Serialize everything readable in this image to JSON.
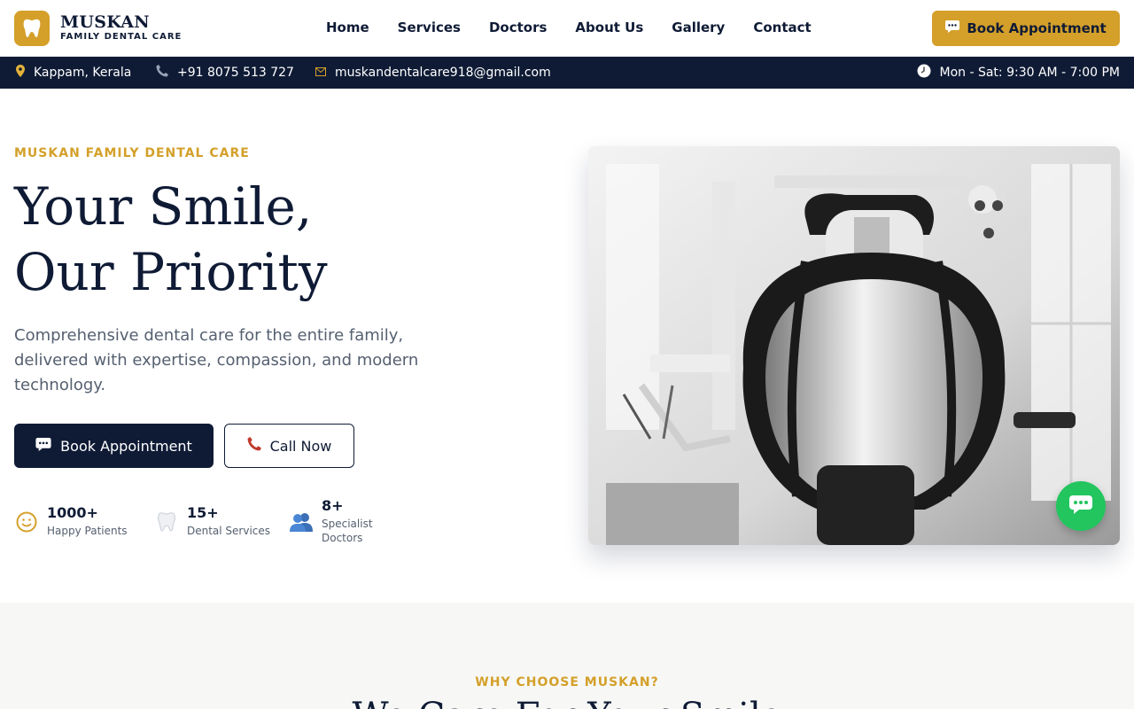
{
  "brand": {
    "name": "MUSKAN",
    "tagline": "FAMILY DENTAL CARE"
  },
  "nav": {
    "items": [
      {
        "label": "Home"
      },
      {
        "label": "Services"
      },
      {
        "label": "Doctors"
      },
      {
        "label": "About Us"
      },
      {
        "label": "Gallery"
      },
      {
        "label": "Contact"
      }
    ]
  },
  "header": {
    "cta_label": "Book Appointment"
  },
  "infobar": {
    "location": "Kappam, Kerala",
    "phone": "+91 8075 513 727",
    "email": "muskandentalcare918@gmail.com",
    "hours": "Mon - Sat: 9:30 AM - 7:00 PM"
  },
  "hero": {
    "eyebrow": "MUSKAN FAMILY DENTAL CARE",
    "title_line1": "Your Smile,",
    "title_line2": "Our Priority",
    "description": "Comprehensive dental care for the entire family, delivered with expertise, compassion, and modern technology.",
    "primary_cta": "Book Appointment",
    "secondary_cta": "Call Now"
  },
  "stats": [
    {
      "value": "1000+",
      "label": "Happy Patients",
      "icon": "smiley-icon"
    },
    {
      "value": "15+",
      "label": "Dental Services",
      "icon": "tooth-icon"
    },
    {
      "value": "8+",
      "label": "Specialist Doctors",
      "icon": "people-icon"
    }
  ],
  "why": {
    "eyebrow": "WHY CHOOSE MUSKAN?",
    "title": "We Care For Your Smile"
  },
  "colors": {
    "navy": "#0f1b35",
    "gold": "#d4a02a",
    "whatsapp": "#22c55e"
  }
}
